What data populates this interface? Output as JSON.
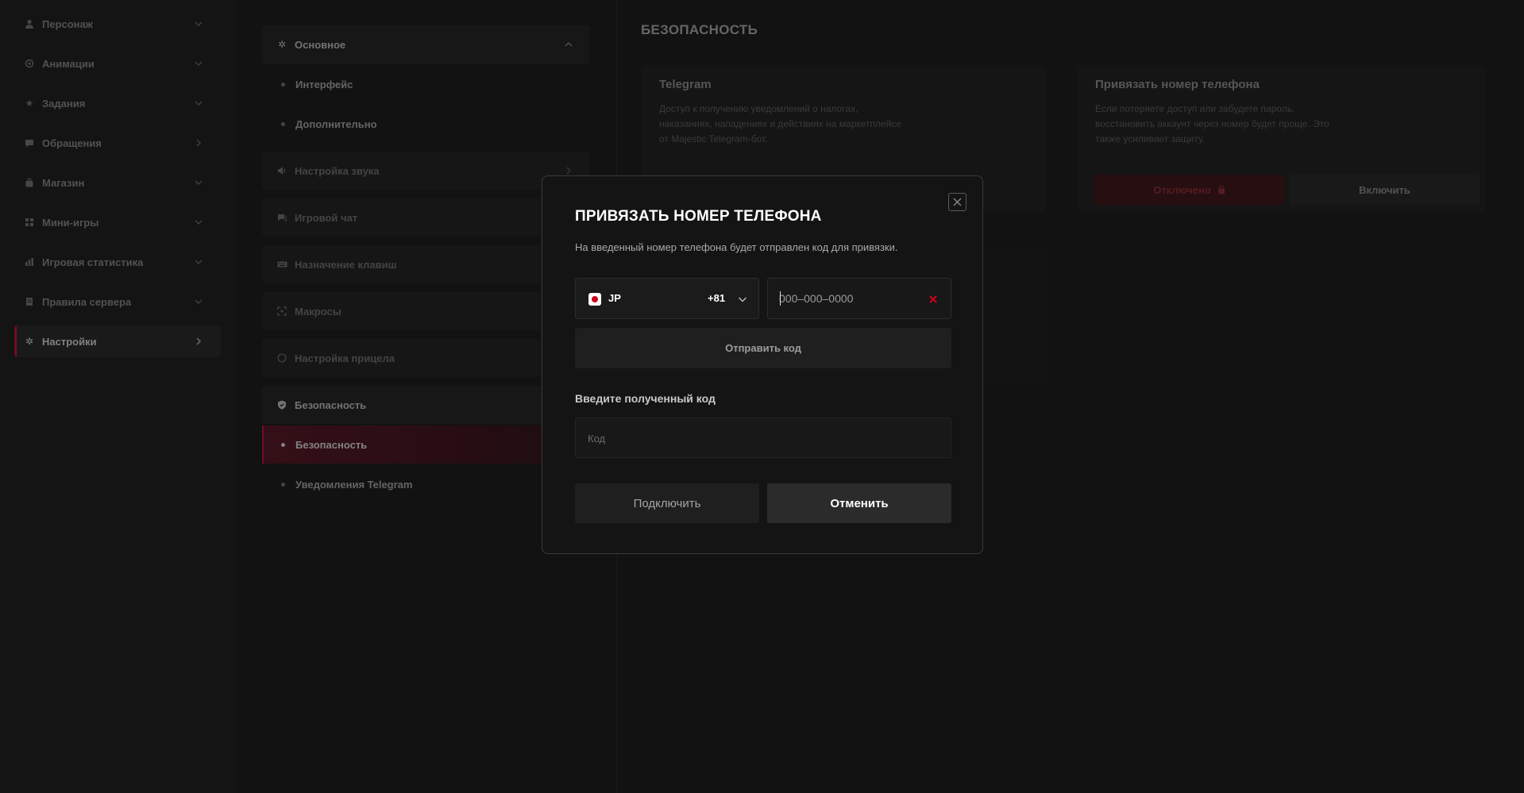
{
  "nav": {
    "items": [
      {
        "label": "Персонаж",
        "icon": "person-icon"
      },
      {
        "label": "Анимации",
        "icon": "animation-icon"
      },
      {
        "label": "Задания",
        "icon": "star-icon"
      },
      {
        "label": "Обращения",
        "icon": "chat-bubble-icon"
      },
      {
        "label": "Магазин",
        "icon": "shopping-bag-icon"
      },
      {
        "label": "Мини-игры",
        "icon": "grid-icon"
      },
      {
        "label": "Игровая статистика",
        "icon": "bar-chart-icon"
      },
      {
        "label": "Правила сервера",
        "icon": "document-icon"
      },
      {
        "label": "Настройки",
        "icon": "gear-icon",
        "active": true
      }
    ]
  },
  "settings": {
    "sections": [
      {
        "label": "Основное",
        "icon": "gear-icon"
      },
      {
        "label": "Настройка звука",
        "icon": "speaker-icon"
      },
      {
        "label": "Игровой чат",
        "icon": "chat-icon"
      },
      {
        "label": "Назначение клавиш",
        "icon": "keyboard-icon"
      },
      {
        "label": "Макросы",
        "icon": "macro-icon"
      },
      {
        "label": "Настройка прицела",
        "icon": "crosshair-icon"
      },
      {
        "label": "Безопасность",
        "icon": "shield-icon"
      }
    ],
    "general_sub": [
      "Интерфейс",
      "Дополнительно"
    ],
    "security_sub": [
      "Безопасность",
      "Уведомления Telegram"
    ]
  },
  "content": {
    "title": "БЕЗОПАСНОСТЬ",
    "telegram": {
      "title": "Telegram",
      "desc": [
        "Доступ к получению уведомлений о налогах,",
        "наказаниях, нападениях и действиях на маркетплейсе",
        "от Majestic Telegram-бот."
      ]
    },
    "phone_card": {
      "title": "Привязать номер телефона",
      "desc": [
        "Если потеряете доступ или забудете пароль,",
        "восстановить аккаунт через номер будет проще. Это",
        "также усиливает защиту."
      ],
      "off_label": "Отключено",
      "on_label": "Включить"
    }
  },
  "modal": {
    "title": "ПРИВЯЗАТЬ НОМЕР ТЕЛЕФОНА",
    "description": "На введенный номер телефона будет отправлен код для привязки.",
    "country_code": "JP",
    "dial_code": "+81",
    "phone_placeholder": "000–000–0000",
    "phone_value": "",
    "send_code_label": "Отправить код",
    "code_label": "Введите полученный код",
    "code_placeholder": "Код",
    "connect_label": "Подключить",
    "cancel_label": "Отменить"
  },
  "colors": {
    "accent": "#7a1023",
    "clear": "#d0021b",
    "background": "#141414"
  }
}
